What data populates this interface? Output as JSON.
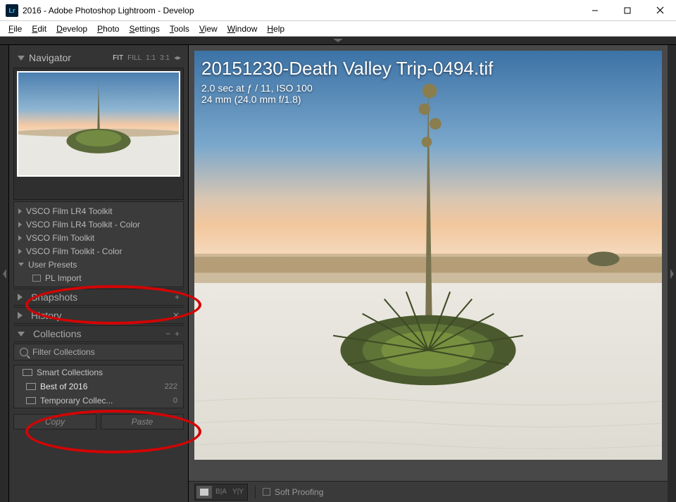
{
  "window": {
    "title": "2016 - Adobe Photoshop Lightroom - Develop",
    "badge": "Lr"
  },
  "menu": [
    "File",
    "Edit",
    "Develop",
    "Photo",
    "Settings",
    "Tools",
    "View",
    "Window",
    "Help"
  ],
  "navigator": {
    "label": "Navigator",
    "zooms": [
      "FIT",
      "FILL",
      "1:1",
      "3:1"
    ],
    "active_zoom": "FIT"
  },
  "presets_tree": [
    {
      "label": "VSCO Film LR4 Toolkit",
      "open": false
    },
    {
      "label": "VSCO Film LR4 Toolkit - Color",
      "open": false
    },
    {
      "label": "VSCO Film Toolkit",
      "open": false
    },
    {
      "label": "VSCO Film Toolkit - Color",
      "open": false
    },
    {
      "label": "User Presets",
      "open": true,
      "children": [
        {
          "label": "PL Import"
        }
      ]
    }
  ],
  "snapshots": {
    "label": "Snapshots"
  },
  "history": {
    "label": "History"
  },
  "collections": {
    "label": "Collections",
    "filter_placeholder": "Filter Collections",
    "items": [
      {
        "label": "Smart Collections",
        "count": "",
        "icon": "smart"
      },
      {
        "label": "Best of 2016",
        "count": "222",
        "icon": "set",
        "selected": true
      },
      {
        "label": "Temporary Collec...",
        "count": "0",
        "icon": "set"
      }
    ]
  },
  "buttons": {
    "copy": "Copy",
    "paste": "Paste"
  },
  "image_overlay": {
    "title": "20151230-Death Valley Trip-0494.tif",
    "line1": "2.0 sec at ƒ / 11, ISO 100",
    "line2": "24 mm (24.0 mm f/1.8)"
  },
  "toolbar": {
    "soft_proofing": "Soft Proofing"
  }
}
